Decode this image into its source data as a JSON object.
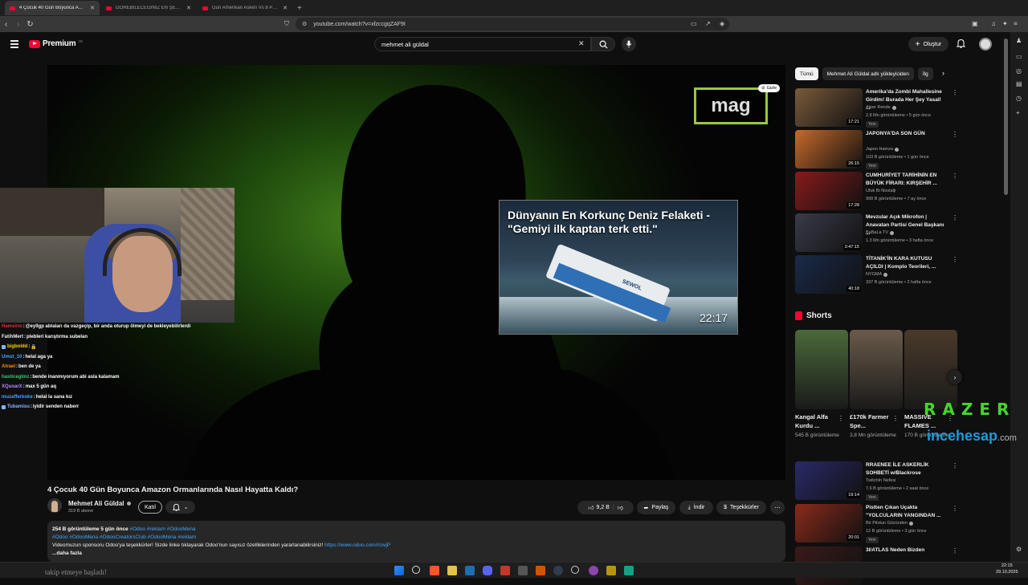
{
  "browser": {
    "tabs": [
      {
        "title": "4 Çocuk 40 Gün Boyunca Amazon Ormanlarında Nasıl Hayatta Kaldı?",
        "active": true
      },
      {
        "title": "GÖREBİLECEĞİNİZ EN ŞEYTANİ BAHİS",
        "active": false
      },
      {
        "title": "Gün Amerikan Askeri Vs 8 Profesyonel",
        "active": false
      }
    ],
    "url": "youtube.com/watch?v=xfzccgqZAF9I"
  },
  "header": {
    "logo_text": "Premium",
    "logo_tr": "TR",
    "search_value": "mehmet ali güldal",
    "create_label": "Oluştur"
  },
  "player": {
    "watermark": "mag",
    "hide_label": "Gizle",
    "end_card": {
      "title": "Dünyanın En Korkunç Deniz Felaketi - \"Gemiyi ilk kaptan terk etti.\"",
      "duration": "22:17",
      "ship_name": "SEWOL"
    }
  },
  "chat": [
    {
      "user": "Hamsirio",
      "color": "#e03030",
      "badge": false,
      "msg": "@eyllgp ablaları da vazgeçip, bir anda oturup ölmeyi de bekleyebilirlerdi"
    },
    {
      "user": "FatihMert",
      "color": "#f1f1f1",
      "badge": false,
      "msg": "plebleri karıştırma subelan"
    },
    {
      "user": "bigboldd",
      "color": "#ffd000",
      "badge": true,
      "msg": "🔒"
    },
    {
      "user": "Umut_10",
      "color": "#3ea6ff",
      "badge": false,
      "msg": "helal aga ya"
    },
    {
      "user": "Atrael",
      "color": "#ff8c00",
      "badge": false,
      "msg": "ben de ya"
    },
    {
      "user": "hasticeglmz",
      "color": "#2ecc71",
      "badge": false,
      "msg": "bende inanmıyorum abi asla kalamam"
    },
    {
      "user": "XQuoarX",
      "color": "#b388ff",
      "badge": false,
      "msg": "max 5 gün aq"
    },
    {
      "user": "muzafferkoke",
      "color": "#3ea6ff",
      "badge": false,
      "msg": "helal la sana kız"
    },
    {
      "user": "Tubamisu",
      "color": "#7fb7ff",
      "badge": true,
      "msg": "iyidir senden naberr"
    }
  ],
  "video": {
    "title": "4 Çocuk 40 Gün Boyunca Amazon Ormanlarında Nasıl Hayatta Kaldı?",
    "channel": "Mehmet Ali Güldal",
    "subscribers": "319 B abone",
    "join_label": "Katıl",
    "likes": "9,2 B",
    "share_label": "Paylaş",
    "download_label": "İndir",
    "thanks_label": "Teşekkürler",
    "views_meta": "254 B görüntüleme  5 gün önce",
    "meta_tags": "#Odoo #reklam #OdooMena",
    "desc_tags": "#Odoo #OdooMena #OdooCreatorsClub #OdooMena #reklam",
    "desc_text": "Videomuzun sponsoru Odoo'ya teşekkürler! Sizde linke tıklayarak Odoo'nun sayısız özelliklerinden yararlanabilirsiniz!",
    "desc_link": "https://www.odoo.com/r/ovjP",
    "more_label": "...daha fazla"
  },
  "chips": [
    "Tümü",
    "Mehmet Ali Güldal adlı yükleyiciden",
    "İlg"
  ],
  "recommendations": [
    {
      "title": "Amerika'da Zombi Mahallesine Girdim! Burada Her Şey Yasal! ...",
      "channel": "Alper Rende",
      "verified": true,
      "meta": "2,8 Mn görüntüleme • 5 gün önce",
      "new": "Yeni",
      "duration": "17:21",
      "thumb": "#7a5a3a"
    },
    {
      "title": "JAPONYA'DA SON GÜN",
      "channel": "Japon Hamza",
      "verified": true,
      "meta": "103 B görüntüleme • 1 gün önce",
      "new": "Yeni",
      "duration": "26:15",
      "thumb": "#c86a2a"
    },
    {
      "title": "CUMHURİYET TARİHİNİN EN BÜYÜK FİRARI: KIRŞEHİR ...",
      "channel": "Ufuk Bi Nostalji",
      "verified": false,
      "meta": "998 B görüntüleme • 7 ay önce",
      "new": "",
      "duration": "17:28",
      "thumb": "#8a1a1a"
    },
    {
      "title": "Mevzular Açık Mikrofon | Anavatan Partisi Genel Başkanı ...",
      "channel": "BaBaLa TV",
      "verified": true,
      "meta": "1,3 Mn görüntüleme • 3 hafta önce",
      "new": "",
      "duration": "3:47:15",
      "thumb": "#3a3a4a"
    },
    {
      "title": "TİTANİK'İN KARA KUTUSU AÇILDI | Komplo Teorileri, ...",
      "channel": "NYGMA",
      "verified": true,
      "meta": "337 B görüntüleme • 2 hafta önce",
      "new": "",
      "duration": "40:18",
      "thumb": "#1a2a4a"
    }
  ],
  "shorts_title": "Shorts",
  "shorts": [
    {
      "title": "Kangal Alfa Kurdu ...",
      "views": "545 B görüntüleme",
      "thumb": "#4a6a3a"
    },
    {
      "title": "£170k Farmer Spe...",
      "views": "3,8 Mn görüntüleme",
      "thumb": "#6a5a4a"
    },
    {
      "title": "MASSIVE FLAMES ...",
      "views": "170 B görüntüleme",
      "thumb": "#4a3a2a"
    }
  ],
  "recommendations2": [
    {
      "title": "RRAENEE İLE ASKERLİK SOHBETİ w/Blackrose",
      "channel": "TwitchIn Nefesi",
      "verified": false,
      "meta": "7,6 B görüntüleme • 2 saat önce",
      "new": "Yeni",
      "duration": "19:14",
      "thumb": "#2a2a6a"
    },
    {
      "title": "Pistten Çıkan Uçakta \"YOLCULARIN YANGINDAN ...",
      "channel": "Bir Pilotun Gözünden",
      "verified": true,
      "meta": "12 B görüntüleme • 3 gün önce",
      "new": "Yeni",
      "duration": "20:01",
      "thumb": "#8a2a1a"
    },
    {
      "title": "3I/ATLAS Neden Bizden",
      "channel": "",
      "verified": false,
      "meta": "",
      "new": "",
      "duration": "",
      "thumb": "#3a1a1a"
    }
  ],
  "overlays": {
    "razer": "RAZER",
    "incehesap": "incehesap",
    "incehesap_com": ".com",
    "ticker": "takip etmeye başladı!"
  },
  "clock": {
    "time": "22:15",
    "date": "29.10.2025"
  }
}
